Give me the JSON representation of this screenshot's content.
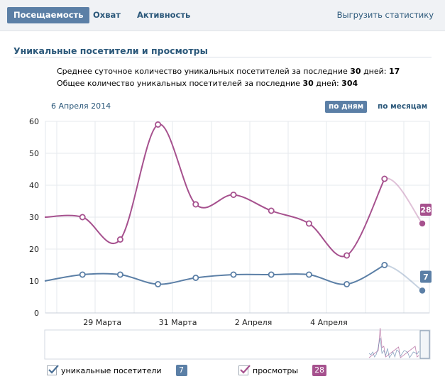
{
  "tabs": [
    {
      "label": "Посещаемость",
      "active": true
    },
    {
      "label": "Охват",
      "active": false
    },
    {
      "label": "Активность",
      "active": false
    }
  ],
  "export_link": "Выгрузить статистику",
  "section_title": "Уникальные посетители и просмотры",
  "stats": {
    "avg_text": "Среднее суточное количество уникальных посетителей за последние",
    "avg_days": "30",
    "avg_days_suffix": "дней:",
    "avg_value": "17",
    "total_text": "Общее количество уникальных посетителей за последние",
    "total_days": "30",
    "total_days_suffix": "дней:",
    "total_value": "304"
  },
  "current_date": "6 Апреля 2014",
  "mode_buttons": {
    "by_day": "по дням",
    "by_month": "по месяцам",
    "active": "by_day"
  },
  "colors": {
    "visitors": "#5b7fa6",
    "views": "#a6518e",
    "grid": "#e6e9ee",
    "axis_text": "#222222",
    "date_text": "#2b587a"
  },
  "chart_data": {
    "type": "line",
    "title": "",
    "xlabel": "",
    "ylabel": "",
    "ylim": [
      0,
      60
    ],
    "yticks": [
      0,
      10,
      20,
      30,
      40,
      50,
      60
    ],
    "grid": true,
    "x_tick_labels": [
      "29 Марта",
      "31 Марта",
      "2 Апреля",
      "4 Апреля"
    ],
    "x_ticks_at": [
      1,
      3,
      5,
      7
    ],
    "x": [
      0,
      1,
      2,
      3,
      4,
      5,
      6,
      7,
      8,
      9,
      10
    ],
    "series": [
      {
        "name": "уникальные посетители",
        "color_key": "visitors",
        "values": [
          10,
          12,
          12,
          9,
          11,
          12,
          12,
          12,
          9,
          15,
          7
        ],
        "latest": "7"
      },
      {
        "name": "просмотры",
        "color_key": "views",
        "values": [
          30,
          30,
          23,
          59,
          34,
          37,
          32,
          28,
          18,
          42,
          28
        ],
        "latest": "28"
      }
    ],
    "legend_position": "bottom"
  }
}
